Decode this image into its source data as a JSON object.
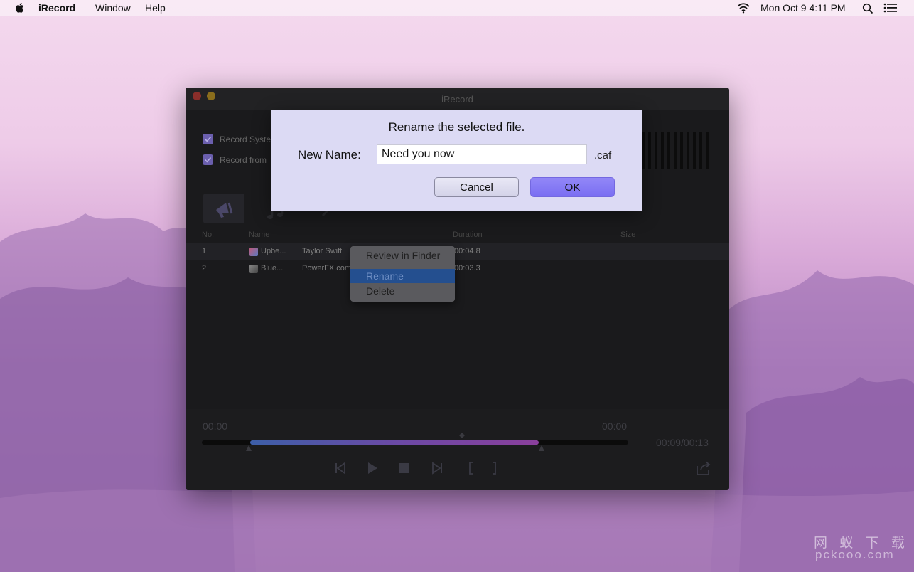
{
  "menubar": {
    "app_name": "iRecord",
    "items": [
      "Window",
      "Help"
    ],
    "clock": "Mon Oct 9  4:11 PM"
  },
  "window": {
    "title": "iRecord",
    "options": [
      {
        "label": "Record System",
        "checked": true
      },
      {
        "label": "Record from",
        "checked": true
      }
    ],
    "columns": {
      "no": "No.",
      "name": "Name",
      "duration": "Duration",
      "size": "Size"
    },
    "rows": [
      {
        "no": "1",
        "name": "Upbe...",
        "artist": "Taylor Swift",
        "duration": "00:04.8"
      },
      {
        "no": "2",
        "name": "Blue...",
        "artist": "PowerFX.com",
        "duration": "00:03.3"
      }
    ],
    "player": {
      "start_time": "00:00",
      "end_time": "00:00",
      "position": "00:09/00:13",
      "progress": 0.69
    }
  },
  "context_menu": {
    "items": [
      "Review in Finder",
      "Rename",
      "Delete"
    ],
    "selected": "Rename"
  },
  "dialog": {
    "title": "Rename the selected file.",
    "label": "New Name:",
    "value": "Need you now",
    "extension": ".caf",
    "cancel_label": "Cancel",
    "ok_label": "OK"
  },
  "watermark": {
    "line1": "网 蚁 下 载",
    "line2": "pckooo.com"
  }
}
